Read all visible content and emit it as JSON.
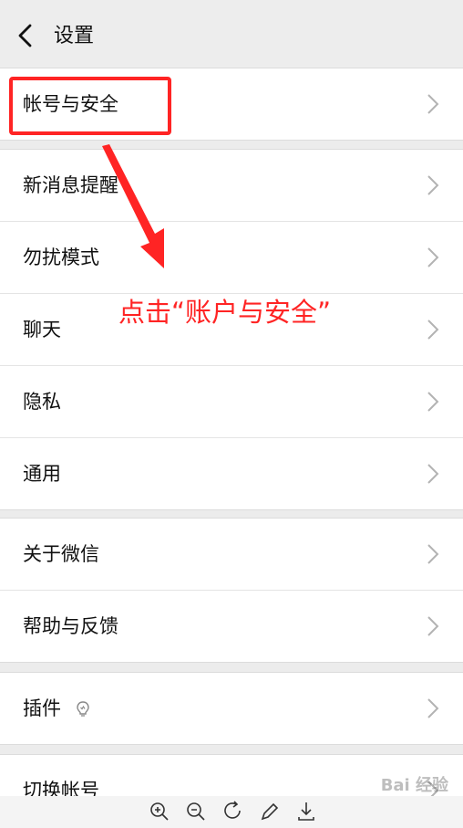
{
  "header": {
    "title": "设置",
    "back_icon": "chevron-left-icon"
  },
  "groups": [
    {
      "items": [
        "帐号与安全"
      ]
    },
    {
      "items": [
        "新消息提醒",
        "勿扰模式",
        "聊天",
        "隐私",
        "通用"
      ]
    },
    {
      "items": [
        "关于微信",
        "帮助与反馈"
      ]
    },
    {
      "items": [
        "插件"
      ]
    },
    {
      "items": [
        "切换帐号"
      ]
    }
  ],
  "annotation": {
    "text": "点击“账户与安全”",
    "color": "#ff2424"
  },
  "bottom_toolbar": {
    "icons": [
      "zoom-in-icon",
      "zoom-out-icon",
      "rotate-icon",
      "edit-icon",
      "download-icon"
    ]
  },
  "watermark": {
    "text": "Bai 经验"
  }
}
